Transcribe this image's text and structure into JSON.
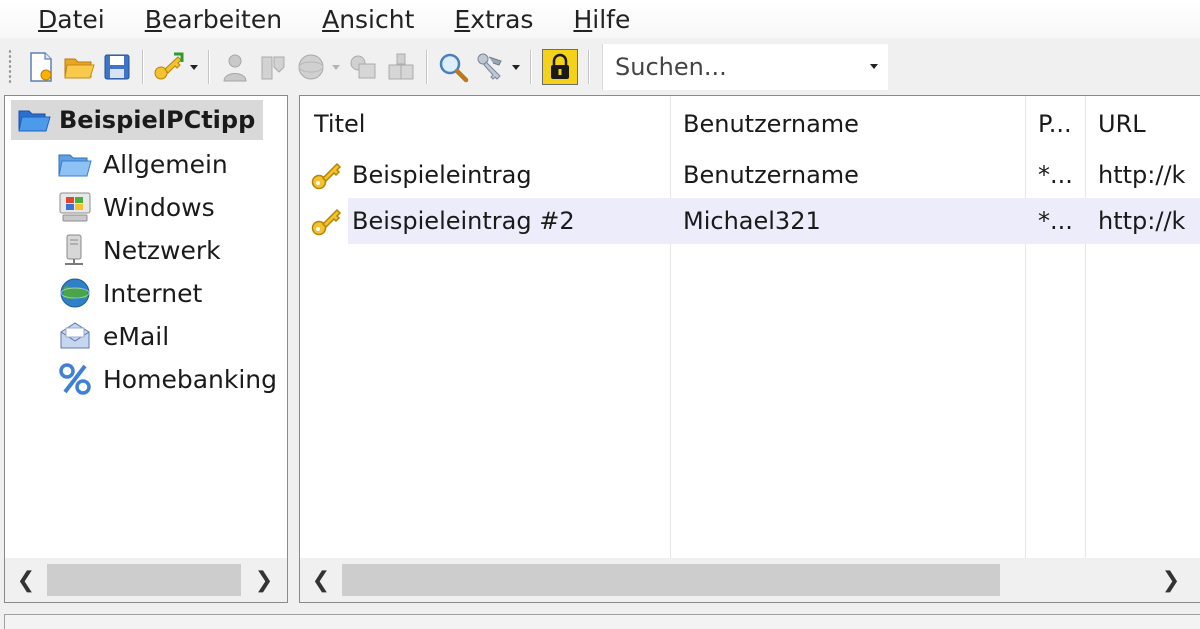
{
  "menu": [
    "Datei",
    "Bearbeiten",
    "Ansicht",
    "Extras",
    "Hilfe"
  ],
  "toolbar": {
    "buttons": [
      "new-database-icon",
      "open-database-icon",
      "save-database-icon",
      "add-entry-icon",
      "copy-username-icon",
      "copy-password-icon",
      "open-url-icon",
      "copy-entry-icon",
      "autotype-icon",
      "find-icon",
      "password-generator-icon",
      "lock-workspace-icon"
    ],
    "search_placeholder": "Suchen..."
  },
  "tree": {
    "root": {
      "label": "BeispielPCtipp",
      "icon": "folder-open-icon"
    },
    "groups": [
      {
        "label": "Allgemein",
        "icon": "folder-icon"
      },
      {
        "label": "Windows",
        "icon": "windows-icon"
      },
      {
        "label": "Netzwerk",
        "icon": "network-server-icon"
      },
      {
        "label": "Internet",
        "icon": "globe-icon"
      },
      {
        "label": "eMail",
        "icon": "envelope-icon"
      },
      {
        "label": "Homebanking",
        "icon": "percent-icon"
      }
    ]
  },
  "list": {
    "columns": [
      "Titel",
      "Benutzername",
      "P...",
      "URL"
    ],
    "rows": [
      {
        "title": "Beispieleintrag",
        "username": "Benutzername",
        "password": "*...",
        "url": "http://k"
      },
      {
        "title": "Beispieleintrag #2",
        "username": "Michael321",
        "password": "*...",
        "url": "http://k"
      }
    ],
    "selected_row": 1
  },
  "colors": {
    "selection": "#ececfa",
    "tree_root_bg": "#d9d9d9",
    "lock_button": "#f5d21a"
  }
}
